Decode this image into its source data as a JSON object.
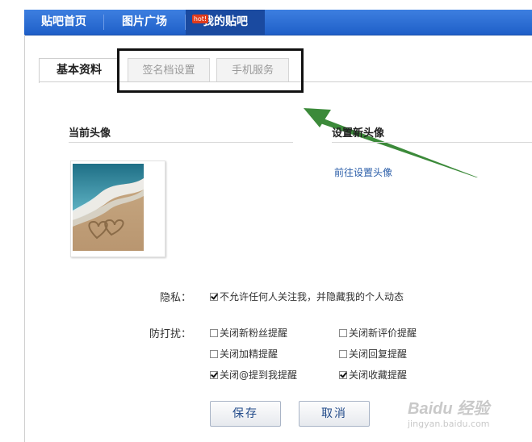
{
  "nav": {
    "items": [
      "贴吧首页",
      "图片广场",
      "我的贴吧"
    ],
    "badge": "hot!"
  },
  "tabs": [
    "基本资料",
    "签名档设置",
    "手机服务"
  ],
  "avatar": {
    "current_title": "当前头像",
    "set_title": "设置新头像",
    "set_link": "前往设置头像"
  },
  "privacy": {
    "label": "隐私：",
    "option": "不允许任何人关注我，并隐藏我的个人动态",
    "checked": true
  },
  "disturb": {
    "label": "防打扰：",
    "options": [
      {
        "label": "关闭新粉丝提醒",
        "checked": false
      },
      {
        "label": "关闭新评价提醒",
        "checked": false
      },
      {
        "label": "关闭加精提醒",
        "checked": false
      },
      {
        "label": "关闭回复提醒",
        "checked": false
      },
      {
        "label": "关闭@提到我提醒",
        "checked": true
      },
      {
        "label": "关闭收藏提醒",
        "checked": true
      }
    ]
  },
  "buttons": {
    "save": "保存",
    "cancel": "取消"
  },
  "watermark": {
    "brand": "Baidu 经验",
    "url": "jingyan.baidu.com"
  },
  "colors": {
    "nav_bg": "#2b6fd6",
    "link": "#2a5da8",
    "arrow": "#3c8a3a"
  }
}
